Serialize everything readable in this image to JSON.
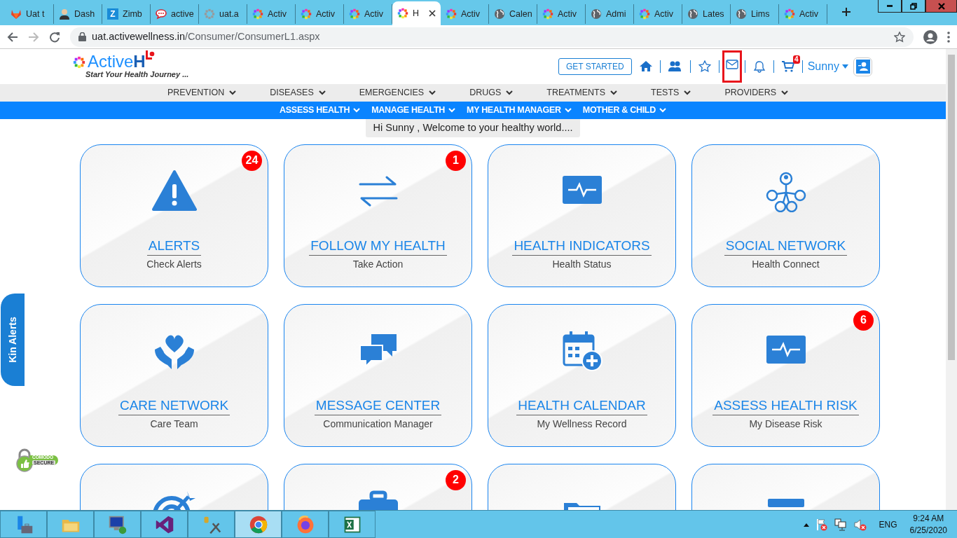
{
  "browser": {
    "tabs": [
      {
        "title": "Uat t",
        "kind": "fox",
        "selected": false
      },
      {
        "title": "Dash",
        "kind": "figure",
        "selected": false
      },
      {
        "title": "Zimb",
        "kind": "letter",
        "icon_letter": "Z",
        "selected": false
      },
      {
        "title": "active",
        "kind": "chat",
        "selected": false
      },
      {
        "title": "uat.a",
        "kind": "spinner",
        "selected": false
      },
      {
        "title": "Activ",
        "kind": "flower",
        "selected": false
      },
      {
        "title": "Activ",
        "kind": "flower",
        "selected": false
      },
      {
        "title": "Activ",
        "kind": "flower",
        "selected": false
      },
      {
        "title": "H",
        "kind": "flower",
        "selected": true
      },
      {
        "title": "Activ",
        "kind": "flower",
        "selected": false
      },
      {
        "title": "Calen",
        "kind": "globe",
        "selected": false
      },
      {
        "title": "Activ",
        "kind": "flower",
        "selected": false
      },
      {
        "title": "Admi",
        "kind": "globe",
        "selected": false
      },
      {
        "title": "Activ",
        "kind": "flower",
        "selected": false
      },
      {
        "title": "Lates",
        "kind": "globe",
        "selected": false
      },
      {
        "title": "Lims",
        "kind": "globe",
        "selected": false
      },
      {
        "title": "Activ",
        "kind": "flower",
        "selected": false
      }
    ],
    "url_host": "uat.activewellness.in",
    "url_path": "/Consumer/ConsumerL1.aspx"
  },
  "header": {
    "logo_text": "Active",
    "logo_letter": "H",
    "tagline": "Start Your Health Journey ...",
    "get_started": "GET STARTED",
    "user": "Sunny",
    "icons": [
      {
        "kind": "home",
        "highlighted": false
      },
      {
        "kind": "users",
        "highlighted": false
      },
      {
        "kind": "star",
        "highlighted": false
      },
      {
        "kind": "mail",
        "highlighted": true
      },
      {
        "kind": "bell",
        "highlighted": false
      },
      {
        "kind": "cart",
        "highlighted": false,
        "count": "4"
      }
    ]
  },
  "menu_primary": [
    "PREVENTION",
    "DISEASES",
    "EMERGENCIES",
    "DRUGS",
    "TREATMENTS",
    "TESTS",
    "PROVIDERS"
  ],
  "menu_secondary": [
    "ASSESS HEALTH",
    "MANAGE HEALTH",
    "MY HEALTH MANAGER",
    "MOTHER & CHILD"
  ],
  "greeting": "Hi Sunny , Welcome to your healthy world....",
  "cards": [
    {
      "kind": "alert",
      "title": "ALERTS",
      "subtitle": "Check Alerts",
      "badge": "24"
    },
    {
      "kind": "swap",
      "title": "FOLLOW MY HEALTH",
      "subtitle": "Take Action",
      "badge": "1"
    },
    {
      "kind": "monitor",
      "title": "HEALTH INDICATORS",
      "subtitle": "Health Status"
    },
    {
      "kind": "network",
      "title": "SOCIAL NETWORK",
      "subtitle": "Health Connect"
    },
    {
      "kind": "hands",
      "title": "CARE NETWORK",
      "subtitle": "Care Team"
    },
    {
      "kind": "chat",
      "title": "MESSAGE CENTER",
      "subtitle": "Communication Manager"
    },
    {
      "kind": "calendar",
      "title": "HEALTH CALENDAR",
      "subtitle": "My Wellness Record"
    },
    {
      "kind": "monitor",
      "title": "ASSESS HEALTH RISK",
      "subtitle": "My Disease Risk",
      "badge": "6"
    },
    {
      "kind": "target"
    },
    {
      "kind": "briefcase",
      "badge": "2"
    },
    {
      "kind": "folder"
    },
    {
      "kind": "server"
    }
  ],
  "side_tab": "Kin Alerts",
  "seal": {
    "line_1": "COMODO",
    "line_2": "SECURE"
  },
  "taskbar": {
    "apps": [
      {
        "kind": "toolbox",
        "selected": false
      },
      {
        "kind": "folder",
        "selected": false
      },
      {
        "kind": "remote",
        "selected": false
      },
      {
        "kind": "studio",
        "selected": false
      },
      {
        "kind": "tools",
        "selected": false
      },
      {
        "kind": "chrome",
        "selected": true
      },
      {
        "kind": "firefox",
        "selected": false
      },
      {
        "kind": "excel",
        "selected": false
      }
    ],
    "language": "ENG",
    "time": "9:24 AM",
    "date": "6/25/2020"
  }
}
